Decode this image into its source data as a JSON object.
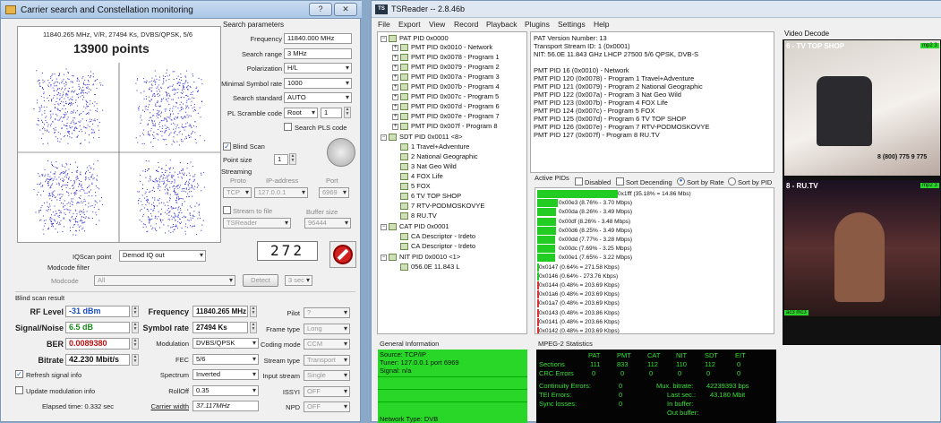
{
  "dialog": {
    "title": "Carrier search and Constellation monitoring",
    "help_btn": "?",
    "close_btn": "✕",
    "const_info": "11840.265 MHz, V/R, 27494 Ks, DVBS/QPSK, 5/6",
    "points": "13900 points",
    "search_params": "Search parameters",
    "frequency_lbl": "Frequency",
    "frequency": "11840.000 MHz",
    "range_lbl": "Search range",
    "range": "3 MHz",
    "pol_lbl": "Polarization",
    "pol": "H/L",
    "minsym_lbl": "Minimal Symbol rate",
    "minsym": "1000",
    "std_lbl": "Search standard",
    "std": "AUTO",
    "pl_lbl": "PL Scramble code",
    "pl": "Root",
    "pl_num": "1",
    "search_pls": "Search PLS code",
    "blind_scan": "Blind Scan",
    "point_size_lbl": "Point size",
    "point_size": "1",
    "streaming": "Streaming",
    "proto_lbl": "Proto",
    "ip_lbl": "IP-address",
    "port_lbl": "Port",
    "proto": "TCP",
    "ip": "127.0.0.1",
    "port": "6969",
    "stream_file": "Stream to file",
    "buffer_lbl": "Buffer size",
    "tsreader": "TSReader",
    "buffer": "96444",
    "iq_lbl": "IQScan point",
    "iq": "Demod IQ out",
    "digits": "272",
    "modcode_filter": "Modcode filter",
    "modcode_lbl": "Modcode",
    "modcode": "All",
    "detect": "Detect",
    "sec": "3 sec",
    "bs_result": "Blind scan result",
    "rf_lbl": "RF Level",
    "rf": "-31 dBm",
    "snr_lbl": "Signal/Noise",
    "snr": "6.5 dB",
    "ber_lbl": "BER",
    "ber": "0.0089380",
    "bitrate_lbl": "Bitrate",
    "bitrate": "42.230 Mbit/s",
    "freq2_lbl": "Frequency",
    "freq2": "11840.265 MHz",
    "sym_lbl": "Symbol rate",
    "sym": "27494 Ks",
    "mod_lbl": "Modulation",
    "mod": "DVBS/QPSK",
    "fec_lbl": "FEC",
    "fec": "5/6",
    "spec_lbl": "Spectrum",
    "spec": "Inverted",
    "roll_lbl": "RollOff",
    "roll": "0.35",
    "cw_lbl": "Carrier width",
    "cw": "37.117MHz",
    "pilot_lbl": "Pilot",
    "pilot": "?",
    "frame_lbl": "Frame type",
    "frame": "Long",
    "coding_lbl": "Coding mode",
    "coding": "CCM",
    "stype_lbl": "Stream type",
    "stype": "Transport",
    "istream_lbl": "Input stream",
    "istream": "Single",
    "issyi_lbl": "ISSYI",
    "issyi": "OFF",
    "npd_lbl": "NPD",
    "npd": "OFF",
    "refresh": "Refresh signal info",
    "update_mod": "Update modulation info",
    "elapsed": "Elapsed time: 0.332 sec"
  },
  "tsr": {
    "title": "TSReader -- 2.8.46b",
    "logo": "TS",
    "menu": [
      "File",
      "Export",
      "View",
      "Record",
      "Playback",
      "Plugins",
      "Settings",
      "Help"
    ],
    "tree": [
      "PAT PID 0x0000",
      "PMT PID 0x0010 - Network",
      "PMT PID 0x0078 - Program 1",
      "PMT PID 0x0079 - Program 2",
      "PMT PID 0x007a - Program 3",
      "PMT PID 0x007b - Program 4",
      "PMT PID 0x007c - Program 5",
      "PMT PID 0x007d - Program 6",
      "PMT PID 0x007e - Program 7",
      "PMT PID 0x007f - Program 8",
      "SDT PID 0x0011 <8>",
      "1 Travel+Adventure",
      "2 National Geographic",
      "3 Nat Geo Wild",
      "4 FOX Life",
      "5 FOX",
      "6 TV TOP SHOP",
      "7 RTV-PODMOSKOVYE",
      "8 RU.TV",
      "CAT PID 0x0001",
      "CA Descriptor - Irdeto",
      "CA Descriptor - Irdeto",
      "NIT PID 0x0010 <1>",
      "056.0E 11.843 L"
    ],
    "info": [
      "PAT Version Number: 13",
      "Transport Stream ID: 1 (0x0001)",
      "NIT: 56.0E 11.843 GHz LHCP 27500 5/6 QPSK, DVB-S",
      "",
      "PMT PID 16 (0x0010) - Network",
      "PMT PID 120 (0x0078) - Program 1 Travel+Adventure",
      "PMT PID 121 (0x0079) - Program 2 National Geographic",
      "PMT PID 122 (0x007a) - Program 3 Nat Geo Wild",
      "PMT PID 123 (0x007b) - Program 4 FOX Life",
      "PMT PID 124 (0x007c) - Program 5 FOX",
      "PMT PID 125 (0x007d) - Program 6 TV TOP SHOP",
      "PMT PID 126 (0x007e) - Program 7 RTV-PODMOSKOVYE",
      "PMT PID 127 (0x007f) - Program 8 RU.TV"
    ],
    "active_pids": "Active PIDs",
    "disabled": "Disabled",
    "sort_desc": "Sort Decending",
    "sort_rate": "Sort by Rate",
    "sort_pid": "Sort by PID",
    "pids": [
      {
        "t": "0x1fff (35.18% = 14.86 Mbs)",
        "f": 1.0
      },
      {
        "t": "0x00e3 (8.76% - 3.70 Mbps)",
        "f": 0.25
      },
      {
        "t": "0x00da (8.26% - 3.49 Mbps)",
        "f": 0.23
      },
      {
        "t": "0x00df (8.26% - 3.48 Mbps)",
        "f": 0.23
      },
      {
        "t": "0x00d6 (8.25% - 3.49 Mbps)",
        "f": 0.23
      },
      {
        "t": "0x00dd (7.77% - 3.28 Mbps)",
        "f": 0.22
      },
      {
        "t": "0x00dc (7.69% - 3.25 Mbps)",
        "f": 0.22
      },
      {
        "t": "0x00e1 (7.65% - 3.22 Mbps)",
        "f": 0.22
      },
      {
        "t": "0x0147 (0.64% = 271.58 Kbps)",
        "f": 0.02
      },
      {
        "t": "0x0146 (0.64% - 273.76 Kbps)",
        "f": 0.02
      },
      {
        "t": "0x0144 (0.48% = 203.69 Kbps)",
        "f": 0.01
      },
      {
        "t": "0x01a6 (0.48% = 203.69 Kbps)",
        "f": 0.01
      },
      {
        "t": "0x01a7 (0.48% = 203.69 Kbps)",
        "f": 0.01
      },
      {
        "t": "0x0143 (0.48% = 203.86 Kbps)",
        "f": 0.01
      },
      {
        "t": "0x0141 (0.48% = 203.66 Kbps)",
        "f": 0.01
      },
      {
        "t": "0x0142 (0.48% = 203.69 Kbps)",
        "f": 0.01
      }
    ],
    "video_decode": "Video Decode",
    "ch1": "6 - TV TOP SHOP",
    "ch1_badge": "mp2 3",
    "ch1_phone": "8 (800) 775 9 775",
    "ch2": "8 - RU.TV",
    "ch2_badge": "mp2 3",
    "ch2_badge2": "ac3 mc3",
    "gen_info": "General Information",
    "gi": [
      "Source: TCP/IP",
      "Tuner: 127.0.0.1 port 6969",
      "Signal: n/a",
      "",
      "",
      "",
      "Network Type: DVB"
    ],
    "mpeg_stats": "MPEG-2 Statistics",
    "st_hdr": [
      "PAT",
      "PMT",
      "CAT",
      "NIT",
      "SDT",
      "EIT"
    ],
    "sections_lbl": "Sections",
    "sections": [
      "111",
      "833",
      "112",
      "110",
      "112",
      "0"
    ],
    "crc_lbl": "CRC Errors",
    "crc": [
      "0",
      "0",
      "0",
      "0",
      "0",
      "0"
    ],
    "cont_lbl": "Continuity Errors:",
    "cont": "0",
    "tei_lbl": "TEI Errors:",
    "tei": "0",
    "sync_lbl": "Sync losses:",
    "sync": "0",
    "mux_lbl": "Mux. bitrate:",
    "mux": "42239393 bps",
    "last_lbl": "Last sec.:",
    "last": "43.180 Mbit",
    "inbuf_lbl": "In buffer:",
    "outbuf_lbl": "Out buffer:"
  }
}
